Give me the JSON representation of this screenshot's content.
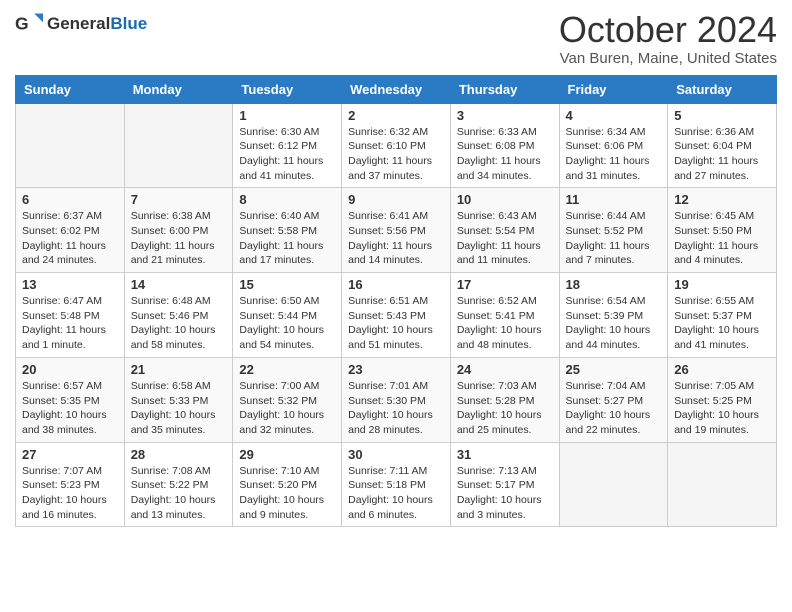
{
  "header": {
    "title": "October 2024",
    "subtitle": "Van Buren, Maine, United States",
    "logo_general": "General",
    "logo_blue": "Blue"
  },
  "weekdays": [
    "Sunday",
    "Monday",
    "Tuesday",
    "Wednesday",
    "Thursday",
    "Friday",
    "Saturday"
  ],
  "weeks": [
    [
      {
        "day": "",
        "sunrise": "",
        "sunset": "",
        "daylight": ""
      },
      {
        "day": "",
        "sunrise": "",
        "sunset": "",
        "daylight": ""
      },
      {
        "day": "1",
        "sunrise": "Sunrise: 6:30 AM",
        "sunset": "Sunset: 6:12 PM",
        "daylight": "Daylight: 11 hours and 41 minutes."
      },
      {
        "day": "2",
        "sunrise": "Sunrise: 6:32 AM",
        "sunset": "Sunset: 6:10 PM",
        "daylight": "Daylight: 11 hours and 37 minutes."
      },
      {
        "day": "3",
        "sunrise": "Sunrise: 6:33 AM",
        "sunset": "Sunset: 6:08 PM",
        "daylight": "Daylight: 11 hours and 34 minutes."
      },
      {
        "day": "4",
        "sunrise": "Sunrise: 6:34 AM",
        "sunset": "Sunset: 6:06 PM",
        "daylight": "Daylight: 11 hours and 31 minutes."
      },
      {
        "day": "5",
        "sunrise": "Sunrise: 6:36 AM",
        "sunset": "Sunset: 6:04 PM",
        "daylight": "Daylight: 11 hours and 27 minutes."
      }
    ],
    [
      {
        "day": "6",
        "sunrise": "Sunrise: 6:37 AM",
        "sunset": "Sunset: 6:02 PM",
        "daylight": "Daylight: 11 hours and 24 minutes."
      },
      {
        "day": "7",
        "sunrise": "Sunrise: 6:38 AM",
        "sunset": "Sunset: 6:00 PM",
        "daylight": "Daylight: 11 hours and 21 minutes."
      },
      {
        "day": "8",
        "sunrise": "Sunrise: 6:40 AM",
        "sunset": "Sunset: 5:58 PM",
        "daylight": "Daylight: 11 hours and 17 minutes."
      },
      {
        "day": "9",
        "sunrise": "Sunrise: 6:41 AM",
        "sunset": "Sunset: 5:56 PM",
        "daylight": "Daylight: 11 hours and 14 minutes."
      },
      {
        "day": "10",
        "sunrise": "Sunrise: 6:43 AM",
        "sunset": "Sunset: 5:54 PM",
        "daylight": "Daylight: 11 hours and 11 minutes."
      },
      {
        "day": "11",
        "sunrise": "Sunrise: 6:44 AM",
        "sunset": "Sunset: 5:52 PM",
        "daylight": "Daylight: 11 hours and 7 minutes."
      },
      {
        "day": "12",
        "sunrise": "Sunrise: 6:45 AM",
        "sunset": "Sunset: 5:50 PM",
        "daylight": "Daylight: 11 hours and 4 minutes."
      }
    ],
    [
      {
        "day": "13",
        "sunrise": "Sunrise: 6:47 AM",
        "sunset": "Sunset: 5:48 PM",
        "daylight": "Daylight: 11 hours and 1 minute."
      },
      {
        "day": "14",
        "sunrise": "Sunrise: 6:48 AM",
        "sunset": "Sunset: 5:46 PM",
        "daylight": "Daylight: 10 hours and 58 minutes."
      },
      {
        "day": "15",
        "sunrise": "Sunrise: 6:50 AM",
        "sunset": "Sunset: 5:44 PM",
        "daylight": "Daylight: 10 hours and 54 minutes."
      },
      {
        "day": "16",
        "sunrise": "Sunrise: 6:51 AM",
        "sunset": "Sunset: 5:43 PM",
        "daylight": "Daylight: 10 hours and 51 minutes."
      },
      {
        "day": "17",
        "sunrise": "Sunrise: 6:52 AM",
        "sunset": "Sunset: 5:41 PM",
        "daylight": "Daylight: 10 hours and 48 minutes."
      },
      {
        "day": "18",
        "sunrise": "Sunrise: 6:54 AM",
        "sunset": "Sunset: 5:39 PM",
        "daylight": "Daylight: 10 hours and 44 minutes."
      },
      {
        "day": "19",
        "sunrise": "Sunrise: 6:55 AM",
        "sunset": "Sunset: 5:37 PM",
        "daylight": "Daylight: 10 hours and 41 minutes."
      }
    ],
    [
      {
        "day": "20",
        "sunrise": "Sunrise: 6:57 AM",
        "sunset": "Sunset: 5:35 PM",
        "daylight": "Daylight: 10 hours and 38 minutes."
      },
      {
        "day": "21",
        "sunrise": "Sunrise: 6:58 AM",
        "sunset": "Sunset: 5:33 PM",
        "daylight": "Daylight: 10 hours and 35 minutes."
      },
      {
        "day": "22",
        "sunrise": "Sunrise: 7:00 AM",
        "sunset": "Sunset: 5:32 PM",
        "daylight": "Daylight: 10 hours and 32 minutes."
      },
      {
        "day": "23",
        "sunrise": "Sunrise: 7:01 AM",
        "sunset": "Sunset: 5:30 PM",
        "daylight": "Daylight: 10 hours and 28 minutes."
      },
      {
        "day": "24",
        "sunrise": "Sunrise: 7:03 AM",
        "sunset": "Sunset: 5:28 PM",
        "daylight": "Daylight: 10 hours and 25 minutes."
      },
      {
        "day": "25",
        "sunrise": "Sunrise: 7:04 AM",
        "sunset": "Sunset: 5:27 PM",
        "daylight": "Daylight: 10 hours and 22 minutes."
      },
      {
        "day": "26",
        "sunrise": "Sunrise: 7:05 AM",
        "sunset": "Sunset: 5:25 PM",
        "daylight": "Daylight: 10 hours and 19 minutes."
      }
    ],
    [
      {
        "day": "27",
        "sunrise": "Sunrise: 7:07 AM",
        "sunset": "Sunset: 5:23 PM",
        "daylight": "Daylight: 10 hours and 16 minutes."
      },
      {
        "day": "28",
        "sunrise": "Sunrise: 7:08 AM",
        "sunset": "Sunset: 5:22 PM",
        "daylight": "Daylight: 10 hours and 13 minutes."
      },
      {
        "day": "29",
        "sunrise": "Sunrise: 7:10 AM",
        "sunset": "Sunset: 5:20 PM",
        "daylight": "Daylight: 10 hours and 9 minutes."
      },
      {
        "day": "30",
        "sunrise": "Sunrise: 7:11 AM",
        "sunset": "Sunset: 5:18 PM",
        "daylight": "Daylight: 10 hours and 6 minutes."
      },
      {
        "day": "31",
        "sunrise": "Sunrise: 7:13 AM",
        "sunset": "Sunset: 5:17 PM",
        "daylight": "Daylight: 10 hours and 3 minutes."
      },
      {
        "day": "",
        "sunrise": "",
        "sunset": "",
        "daylight": ""
      },
      {
        "day": "",
        "sunrise": "",
        "sunset": "",
        "daylight": ""
      }
    ]
  ]
}
